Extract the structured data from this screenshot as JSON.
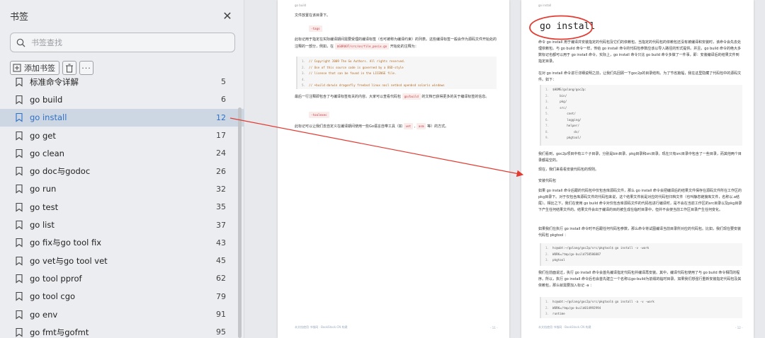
{
  "sidebar": {
    "title": "书签",
    "close_icon": "close-icon",
    "search_placeholder": "书签查找",
    "add_bookmark_label": "添加书签",
    "items": [
      {
        "label": "标准命令详解",
        "page": "5"
      },
      {
        "label": "go build",
        "page": "6"
      },
      {
        "label": "go install",
        "page": "12"
      },
      {
        "label": "go get",
        "page": "17"
      },
      {
        "label": "go clean",
        "page": "24"
      },
      {
        "label": "go doc与godoc",
        "page": "26"
      },
      {
        "label": "go run",
        "page": "32"
      },
      {
        "label": "go test",
        "page": "35"
      },
      {
        "label": "go list",
        "page": "37"
      },
      {
        "label": "go fix与go tool fix",
        "page": "43"
      },
      {
        "label": "go vet与go tool vet",
        "page": "45"
      },
      {
        "label": "go tool pprof",
        "page": "62"
      },
      {
        "label": "go tool cgo",
        "page": "79"
      },
      {
        "label": "go env",
        "page": "91"
      },
      {
        "label": "go fmt与gofmt",
        "page": "95"
      }
    ],
    "active_index": 2
  },
  "page_a": {
    "header": "go build",
    "p1": "文件放置在该目录下。",
    "tag1": "-tags",
    "p2": "此标记用于指定在实际编译期间需要受理的编译标签（也可被称为编译约束）的列表。这些编译标签一般会作为源码文件开始处的注释的一部分，例如，在",
    "p2_code": "$GOROOT/src/os/file_posix.go",
    "p2_tail": "开始处的注释为：",
    "code_lines": [
      "// Copyright 2009 The Go Authors. All rights reserved.",
      "// Use of this source code is governed by a BSD-style",
      "// license that can be found in the LICENSE file.",
      "",
      "// +build darwin dragonfly freebsd linux nacl netbsd openbsd solaris windows"
    ],
    "p3": "最后一行注释即包含了与编译标签有关的内容。大家可以查看代码包",
    "p3_code": "go/build",
    "p3_tail": "的文档已获得更多的关于编译标签的信息。",
    "tag2": "-toolexec",
    "p4": "此标记可以让我们去自定义在编译期间使用一些Go语言自带工具（如",
    "p4_code1": "vet",
    "p4_code2": "asm",
    "p4_tail": "等）的方式。",
    "footer_left": "本文档使用 书栈网 · BookStack.CN 构建",
    "footer_right": "- 11 -"
  },
  "page_b": {
    "header": "go install",
    "heading": "go install",
    "p1": "命令 go install 用于编译并安装指定的代码包及它们的依赖包。当指定的代码包的依赖包还没有被编译和安装时，该命令会先去处理依赖包。与 go build 命令一样，传给 go install 命令的代码包参数应该以导入路径的形式提供。并且，go build 命令的绝大多数标记也都可以用于 go install 命令。实际上，go install 命令只比 go build 命令多做了一件事，即：安装编译后的结果文件到指定目录。",
    "p2": "在对 go install 命令进行详细说明之前，让我们先回顾一下goc2p的目录结构。为了节省篇幅，我在这里隐藏了代码包中的源码文件。如下：",
    "tree": [
      "$HOME/golang/goc2p:",
      "    bin/",
      "    pkg/",
      "    src/",
      "        cnet/",
      "        logging/",
      "        helper/",
      "            ds/",
      "        pkgtool/"
    ],
    "p3": "我们看到，goc2p项目中有三个子目录，分别是bin目录、pkg目录和src目录。现在只有src目录中包含了一些目录，而其他两个目录都是空的。",
    "p4": "现在，我们来看看安装代码包的规则。",
    "p5": "安装代码包",
    "p6": "如果 go install 命令后跟的代码包中仅包含库源码文件，那么 go install 命令会把编译后的结果文件保存在源码文件所在工作区的pkg目录下。对于仅包含库源码文件的代码包来说，这个结果文件就是对应的代码包归档文件（也叫静态链接库文件，名称以.a结尾）。相比之下，我们在使用 go build 命令对仅包含库源码文件的代码包进行编译时，是不会在当前工作区的src目录以及pkg目录下产生任何结果文件的。结果文件会出于编译的目的被生成在临时目录中，但并不会使当前工作区目录产生任何变化。",
    "p7": "如果我们在执行 go install 命令时不后跟任何代码包参数，那么命令将试图编译当前目录所对应的代码包。比如，我们现在要安装代码包 pkgtool ：",
    "code2": [
      "hc@ubt:~/golang/goc2p/src/pkgtool$ go install -v -work",
      "WORK=/tmp/go-build758586887",
      "pkgtool"
    ],
    "p8": "我们在前面说过，执行 go install 命令会首先编译指定代码包并编译再安装。其中，编译代码包使用了与 go build 命令相同的程序。所以，执行 go install 命令后也会首先建立一个名称以go-build为前缀的临时目录。如果我们想强行重新安装指定代码包及其依赖包，那么就需要加入标记 -a ：",
    "code3": [
      "hc@ubt:~/golang/goc2p/src/pkgtool$ go install -a -v -work",
      "WORK=/tmp/go-build014992994",
      "runtime"
    ],
    "footer_left": "本文档使用 书栈网 · BookStack.CN 构建",
    "footer_right": "- 12 -"
  },
  "colors": {
    "accent": "#2f6fc4",
    "annotation": "#e23b32"
  }
}
